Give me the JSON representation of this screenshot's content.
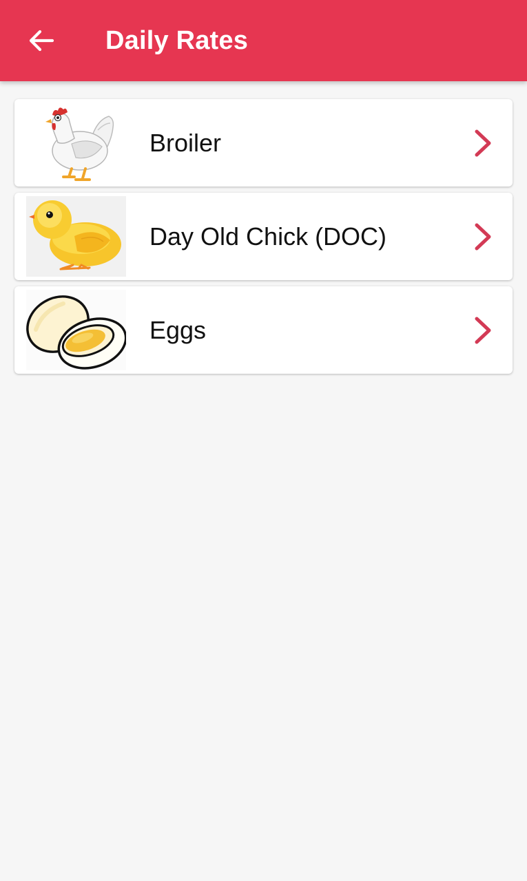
{
  "theme": {
    "accent": "#e63651",
    "background": "#f6f6f6",
    "card": "#ffffff",
    "chevron": "#d33a55"
  },
  "app_bar": {
    "title": "Daily Rates",
    "back_icon": "arrow-left-icon"
  },
  "items": [
    {
      "label": "Broiler",
      "image": "hen-image",
      "trailing_icon": "chevron-right-icon"
    },
    {
      "label": "Day Old Chick (DOC)",
      "image": "chick-image",
      "trailing_icon": "chevron-right-icon"
    },
    {
      "label": "Eggs",
      "image": "boiled-egg-image",
      "trailing_icon": "chevron-right-icon"
    }
  ]
}
